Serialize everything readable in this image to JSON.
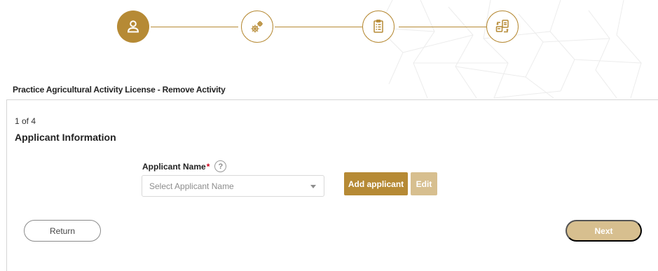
{
  "stepper": {
    "steps": [
      {
        "icon": "user-icon",
        "state": "active"
      },
      {
        "icon": "gears-icon",
        "state": "inactive"
      },
      {
        "icon": "document-checklist-icon",
        "state": "inactive"
      },
      {
        "icon": "document-exchange-icon",
        "state": "inactive"
      }
    ]
  },
  "service": {
    "title": "Practice Agricultural Activity License - Remove Activity"
  },
  "form": {
    "step_count": "1 of 4",
    "section_title": "Applicant Information",
    "applicant_label": "Applicant Name",
    "required_marker": "*",
    "help_glyph": "?",
    "applicant_placeholder": "Select Applicant Name",
    "add_button": "Add applicant",
    "edit_button": "Edit"
  },
  "footer": {
    "return_button": "Return",
    "next_button": "Next"
  },
  "colors": {
    "accent": "#b68a35",
    "accent_light": "#d7bf8f",
    "required": "#d0021b"
  }
}
